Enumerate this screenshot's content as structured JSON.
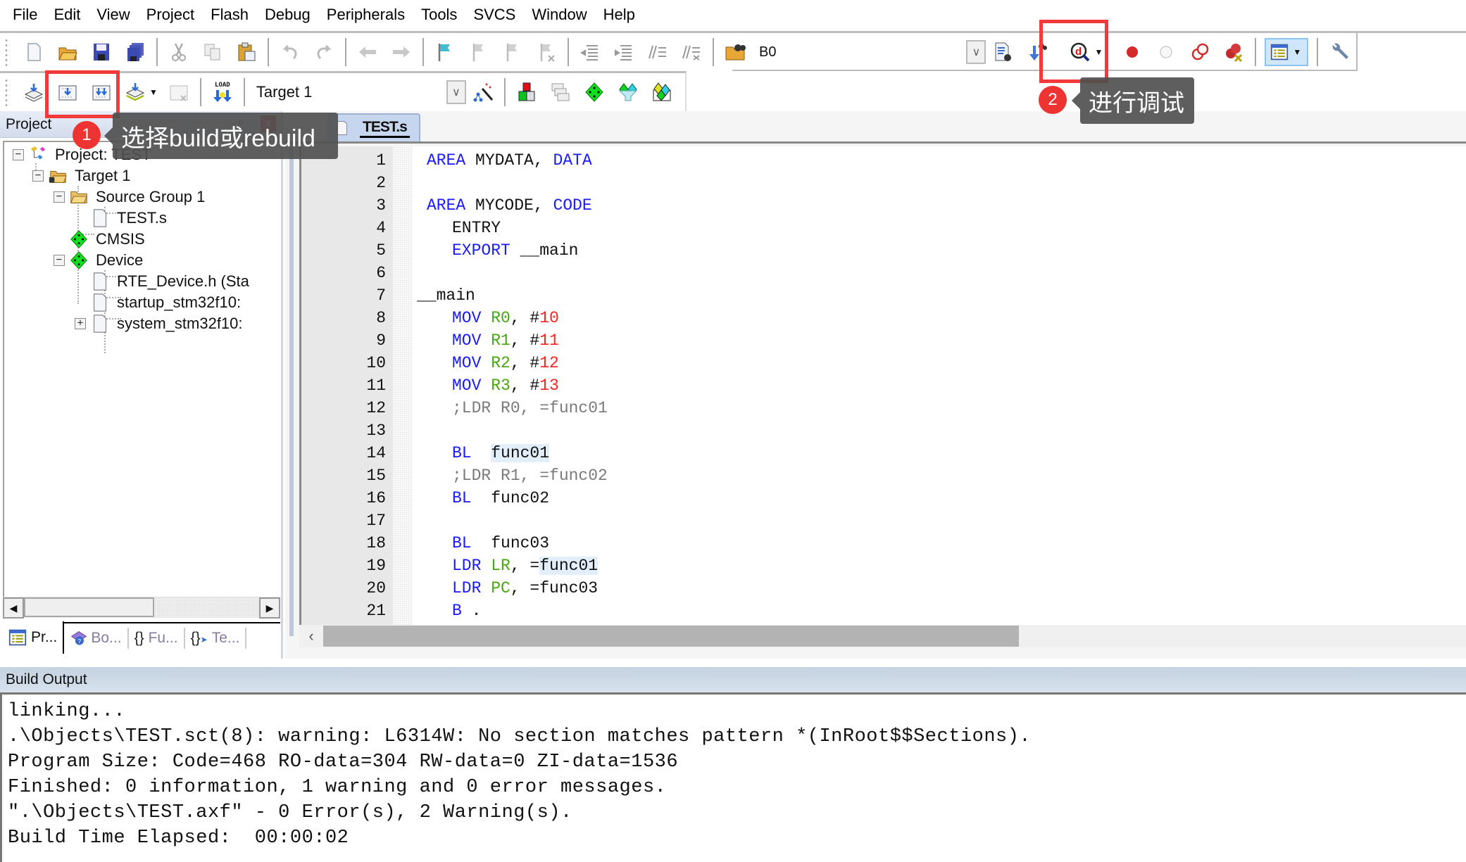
{
  "menu": [
    "File",
    "Edit",
    "View",
    "Project",
    "Flash",
    "Debug",
    "Peripherals",
    "Tools",
    "SVCS",
    "Window",
    "Help"
  ],
  "toolbar1": {
    "buttons": [
      "new-file",
      "open-file",
      "save",
      "save-all",
      "cut",
      "copy",
      "paste",
      "undo",
      "redo",
      "nav-back",
      "nav-forward",
      "bookmark",
      "prev-bookmark",
      "next-bookmark",
      "clear-bookmarks",
      "indent",
      "unindent",
      "comment",
      "uncomment",
      "find-in-files"
    ],
    "find_text": "B0",
    "right_buttons": [
      "find-document",
      "incremental-find",
      "start-debug",
      "insert-breakpoint",
      "enable-breakpoint",
      "disable-all-breakpoints",
      "kill-all-breakpoints",
      "window-layout",
      "configure"
    ]
  },
  "toolbar2": {
    "buttons": [
      "translate",
      "build",
      "rebuild",
      "batch-build",
      "stop-build",
      "download"
    ],
    "load_label": "LOAD",
    "target": "Target 1",
    "right_buttons": [
      "target-options",
      "manage-components",
      "manage-project-items",
      "select-packs",
      "run-time-environment",
      "pack-installer"
    ]
  },
  "project_panel": {
    "title": "Project",
    "pin": "̧",
    "close": "x",
    "tree": [
      {
        "label": "Project: TEST",
        "level": 0,
        "toggle": "−",
        "icon": "project"
      },
      {
        "label": "Target 1",
        "level": 1,
        "toggle": "−",
        "icon": "target-folder"
      },
      {
        "label": "Source Group 1",
        "level": 2,
        "toggle": "−",
        "icon": "folder"
      },
      {
        "label": "TEST.s",
        "level": 3,
        "toggle": "",
        "icon": "file"
      },
      {
        "label": "CMSIS",
        "level": 2,
        "toggle": "",
        "icon": "component"
      },
      {
        "label": "Device",
        "level": 2,
        "toggle": "−",
        "icon": "component"
      },
      {
        "label": "RTE_Device.h (Sta",
        "level": 3,
        "toggle": "",
        "icon": "file"
      },
      {
        "label": "startup_stm32f10:",
        "level": 3,
        "toggle": "",
        "icon": "file"
      },
      {
        "label": "system_stm32f10:",
        "level": 3,
        "toggle": "+",
        "icon": "file"
      }
    ],
    "tabs": [
      "Pr...",
      "Bo...",
      "Fu...",
      "Te..."
    ]
  },
  "editor": {
    "tab": "TEST.s",
    "lines": [
      {
        "n": "1",
        "tokens": [
          {
            "t": "AREA",
            "c": "kw"
          },
          {
            "t": " MYDATA, ",
            "c": "id"
          },
          {
            "t": "DATA",
            "c": "kw"
          }
        ],
        "indent": 1
      },
      {
        "n": "2",
        "tokens": [],
        "indent": 0
      },
      {
        "n": "3",
        "tokens": [
          {
            "t": "AREA",
            "c": "kw"
          },
          {
            "t": " MYCODE, ",
            "c": "id"
          },
          {
            "t": "CODE",
            "c": "kw"
          }
        ],
        "indent": 1
      },
      {
        "n": "4",
        "tokens": [
          {
            "t": "ENTRY",
            "c": "id"
          }
        ],
        "indent": 4
      },
      {
        "n": "5",
        "tokens": [
          {
            "t": "EXPORT",
            "c": "kw"
          },
          {
            "t": " __main",
            "c": "id"
          }
        ],
        "indent": 4
      },
      {
        "n": "6",
        "tokens": [],
        "indent": 0
      },
      {
        "n": "7",
        "tokens": [
          {
            "t": "__main",
            "c": "id"
          }
        ],
        "indent": 0
      },
      {
        "n": "8",
        "tokens": [
          {
            "t": "MOV ",
            "c": "kw"
          },
          {
            "t": "R0",
            "c": "reg"
          },
          {
            "t": ", #",
            "c": "id"
          },
          {
            "t": "10",
            "c": "num"
          }
        ],
        "indent": 4
      },
      {
        "n": "9",
        "tokens": [
          {
            "t": "MOV ",
            "c": "kw"
          },
          {
            "t": "R1",
            "c": "reg"
          },
          {
            "t": ", #",
            "c": "id"
          },
          {
            "t": "11",
            "c": "num"
          }
        ],
        "indent": 4
      },
      {
        "n": "10",
        "tokens": [
          {
            "t": "MOV ",
            "c": "kw"
          },
          {
            "t": "R2",
            "c": "reg"
          },
          {
            "t": ", #",
            "c": "id"
          },
          {
            "t": "12",
            "c": "num"
          }
        ],
        "indent": 4
      },
      {
        "n": "11",
        "tokens": [
          {
            "t": "MOV ",
            "c": "kw"
          },
          {
            "t": "R3",
            "c": "reg"
          },
          {
            "t": ", #",
            "c": "id"
          },
          {
            "t": "13",
            "c": "num"
          }
        ],
        "indent": 4
      },
      {
        "n": "12",
        "tokens": [
          {
            "t": ";LDR R0, =func01",
            "c": "cmt"
          }
        ],
        "indent": 4
      },
      {
        "n": "13",
        "tokens": [],
        "indent": 0
      },
      {
        "n": "14",
        "tokens": [
          {
            "t": "BL",
            "c": "kw"
          },
          {
            "t": "  ",
            "c": "id"
          },
          {
            "t": "func01",
            "c": "hl"
          }
        ],
        "indent": 4
      },
      {
        "n": "15",
        "tokens": [
          {
            "t": ";LDR R1, =func02",
            "c": "cmt"
          }
        ],
        "indent": 4
      },
      {
        "n": "16",
        "tokens": [
          {
            "t": "BL",
            "c": "kw"
          },
          {
            "t": "  func02",
            "c": "id"
          }
        ],
        "indent": 4
      },
      {
        "n": "17",
        "tokens": [],
        "indent": 0
      },
      {
        "n": "18",
        "tokens": [
          {
            "t": "BL",
            "c": "kw"
          },
          {
            "t": "  func03",
            "c": "id"
          }
        ],
        "indent": 4
      },
      {
        "n": "19",
        "tokens": [
          {
            "t": "LDR ",
            "c": "kw"
          },
          {
            "t": "LR",
            "c": "reg"
          },
          {
            "t": ", =",
            "c": "id"
          },
          {
            "t": "func01",
            "c": "hl"
          }
        ],
        "indent": 4
      },
      {
        "n": "20",
        "tokens": [
          {
            "t": "LDR ",
            "c": "kw"
          },
          {
            "t": "PC",
            "c": "reg"
          },
          {
            "t": ", =func03",
            "c": "id"
          }
        ],
        "indent": 4
      },
      {
        "n": "21",
        "tokens": [
          {
            "t": "B",
            "c": "kw"
          },
          {
            "t": " .",
            "c": "id"
          }
        ],
        "indent": 4
      }
    ]
  },
  "build_output": {
    "title": "Build Output",
    "lines": [
      "linking...",
      ".\\Objects\\TEST.sct(8): warning: L6314W: No section matches pattern *(InRoot$$Sections).",
      "Program Size: Code=468 RO-data=304 RW-data=0 ZI-data=1536",
      "Finished: 0 information, 1 warning and 0 error messages.",
      "\".\\Objects\\TEST.axf\" - 0 Error(s), 2 Warning(s).",
      "Build Time Elapsed:  00:00:02"
    ]
  },
  "annotations": [
    {
      "number": "1",
      "text": "选择build或rebuild"
    },
    {
      "number": "2",
      "text": "进行调试"
    }
  ],
  "colors": {
    "highlight": "#f23a3a",
    "keyword": "#1a1aff",
    "register": "#46a80a",
    "number": "#ff2020",
    "comment": "#7a7a7a"
  }
}
